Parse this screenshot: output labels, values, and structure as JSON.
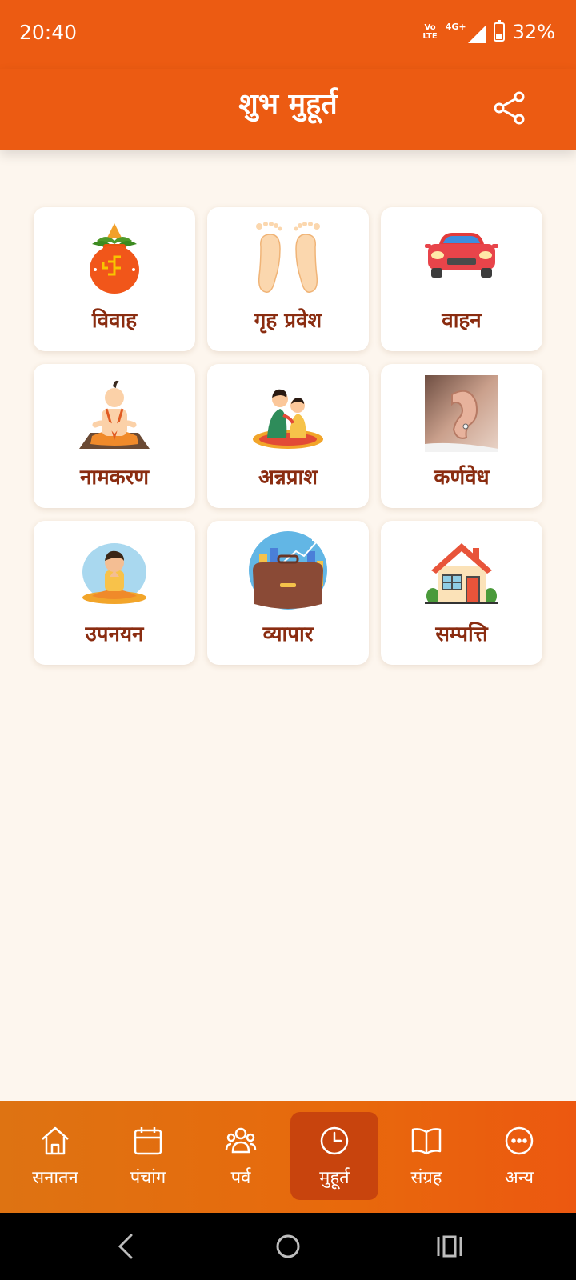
{
  "status": {
    "time": "20:40",
    "volte_top": "Vo",
    "volte_bottom": "LTE",
    "network": "4G+",
    "battery": "32%"
  },
  "header": {
    "title": "शुभ मुहूर्त"
  },
  "cards": [
    {
      "label": "विवाह",
      "icon": "kalash-icon"
    },
    {
      "label": "गृह प्रवेश",
      "icon": "footprints-icon"
    },
    {
      "label": "वाहन",
      "icon": "car-icon"
    },
    {
      "label": "नामकरण",
      "icon": "priest-icon"
    },
    {
      "label": "अन्नप्राश",
      "icon": "mother-child-icon"
    },
    {
      "label": "कर्णवेध",
      "icon": "ear-icon"
    },
    {
      "label": "उपनयन",
      "icon": "meditating-boy-icon"
    },
    {
      "label": "व्यापार",
      "icon": "business-icon"
    },
    {
      "label": "सम्पत्ति",
      "icon": "house-icon"
    }
  ],
  "bottom_nav": [
    {
      "label": "सनातन",
      "icon": "home-icon"
    },
    {
      "label": "पंचांग",
      "icon": "calendar-icon"
    },
    {
      "label": "पर्व",
      "icon": "people-icon"
    },
    {
      "label": "मुहूर्त",
      "icon": "clock-icon",
      "active": true
    },
    {
      "label": "संग्रह",
      "icon": "book-icon"
    },
    {
      "label": "अन्य",
      "icon": "more-icon"
    }
  ],
  "colors": {
    "primary": "#ec5b12",
    "label": "#8a2c10",
    "background": "#fdf6ee",
    "active_tab": "#c8440d"
  }
}
